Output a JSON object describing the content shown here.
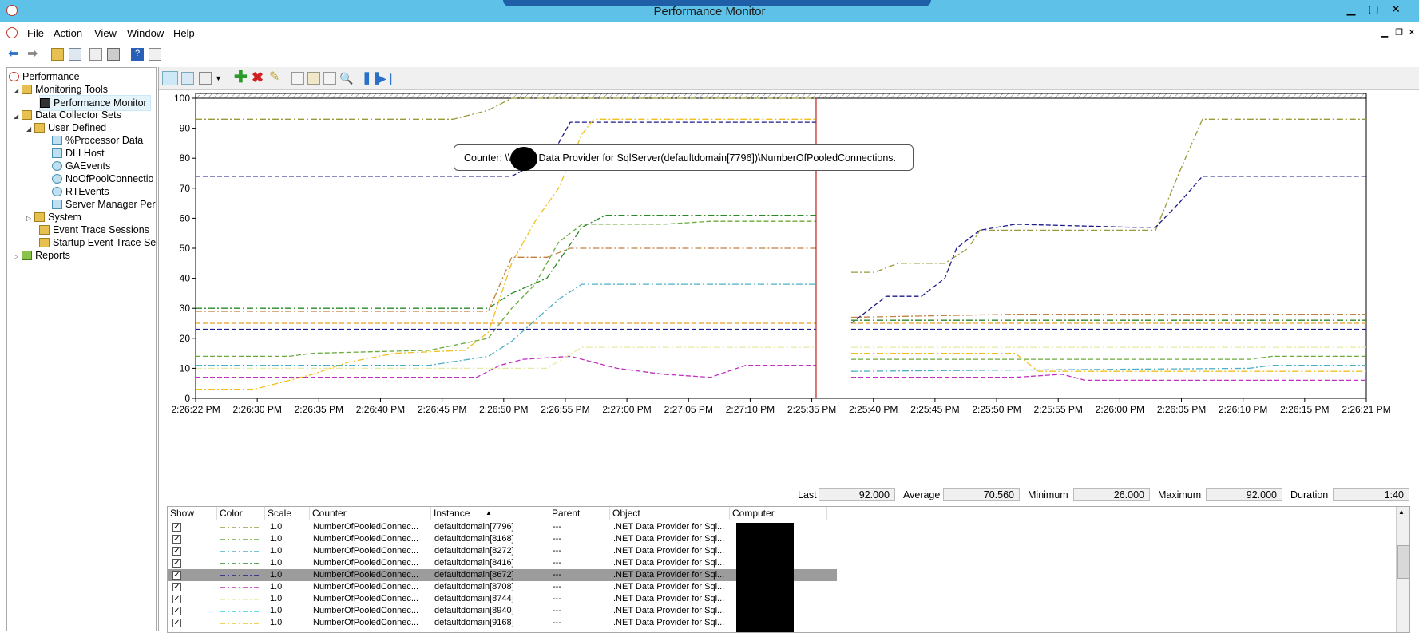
{
  "window": {
    "title": "Performance Monitor"
  },
  "menu": [
    "File",
    "Action",
    "View",
    "Window",
    "Help"
  ],
  "tree": {
    "items": [
      {
        "label": "Performance",
        "level": 0
      },
      {
        "label": "Monitoring Tools",
        "level": 1
      },
      {
        "label": "Performance Monitor",
        "level": 2
      },
      {
        "label": "Data Collector Sets",
        "level": 1
      },
      {
        "label": "User Defined",
        "level": 2
      },
      {
        "label": "%Processor Data",
        "level": 3
      },
      {
        "label": "DLLHost",
        "level": 3
      },
      {
        "label": "GAEvents",
        "level": 3
      },
      {
        "label": "NoOfPoolConnectio",
        "level": 3
      },
      {
        "label": "RTEvents",
        "level": 3
      },
      {
        "label": "Server Manager Per",
        "level": 3
      },
      {
        "label": "System",
        "level": 2
      },
      {
        "label": "Event Trace Sessions",
        "level": 2
      },
      {
        "label": "Startup Event Trace Ses",
        "level": 2
      },
      {
        "label": "Reports",
        "level": 0
      }
    ]
  },
  "tooltip": {
    "text": "Counter: \\\\        .NET Data Provider for SqlServer(defaultdomain[7796])\\NumberOfPooledConnections."
  },
  "stats": {
    "last_label": "Last",
    "last": "92.000",
    "avg_label": "Average",
    "avg": "70.560",
    "min_label": "Minimum",
    "min": "26.000",
    "max_label": "Maximum",
    "max": "92.000",
    "dur_label": "Duration",
    "dur": "1:40"
  },
  "legend": {
    "headers": [
      "Show",
      "Color",
      "Scale",
      "Counter",
      "Instance",
      "Parent",
      "Object",
      "Computer"
    ],
    "rows": [
      {
        "scale": "1.0",
        "counter": "NumberOfPooledConnec...",
        "instance": "defaultdomain[7796]",
        "parent": "---",
        "object": ".NET Data Provider for Sql...",
        "color": "#9a9a3a",
        "selected": false
      },
      {
        "scale": "1.0",
        "counter": "NumberOfPooledConnec...",
        "instance": "defaultdomain[8168]",
        "parent": "---",
        "object": ".NET Data Provider for Sql...",
        "color": "#6aaa3a",
        "selected": false
      },
      {
        "scale": "1.0",
        "counter": "NumberOfPooledConnec...",
        "instance": "defaultdomain[8272]",
        "parent": "---",
        "object": ".NET Data Provider for Sql...",
        "color": "#4ab0c8",
        "selected": false
      },
      {
        "scale": "1.0",
        "counter": "NumberOfPooledConnec...",
        "instance": "defaultdomain[8416]",
        "parent": "---",
        "object": ".NET Data Provider for Sql...",
        "color": "#2a8a2a",
        "selected": false
      },
      {
        "scale": "1.0",
        "counter": "NumberOfPooledConnec...",
        "instance": "defaultdomain[8672]",
        "parent": "---",
        "object": ".NET Data Provider for Sql...",
        "color": "#1a1a8a",
        "selected": true
      },
      {
        "scale": "1.0",
        "counter": "NumberOfPooledConnec...",
        "instance": "defaultdomain[8708]",
        "parent": "---",
        "object": ".NET Data Provider for Sql...",
        "color": "#c030c0",
        "selected": false
      },
      {
        "scale": "1.0",
        "counter": "NumberOfPooledConnec...",
        "instance": "defaultdomain[8744]",
        "parent": "---",
        "object": ".NET Data Provider for Sql...",
        "color": "#e8e8a0",
        "selected": false
      },
      {
        "scale": "1.0",
        "counter": "NumberOfPooledConnec...",
        "instance": "defaultdomain[8940]",
        "parent": "---",
        "object": ".NET Data Provider for Sql...",
        "color": "#30d0e0",
        "selected": false
      },
      {
        "scale": "1.0",
        "counter": "NumberOfPooledConnec...",
        "instance": "defaultdomain[9168]",
        "parent": "---",
        "object": ".NET Data Provider for Sql...",
        "color": "#f0c020",
        "selected": false
      }
    ]
  },
  "chart_data": {
    "type": "line",
    "ylim": [
      0,
      100
    ],
    "yticks": [
      "100",
      "90",
      "80",
      "70",
      "60",
      "50",
      "40",
      "30",
      "20",
      "10",
      "0"
    ],
    "xticks": [
      "2:26:22 PM",
      "2:26:30 PM",
      "2:26:35 PM",
      "2:26:40 PM",
      "2:26:45 PM",
      "2:26:50 PM",
      "2:26:55 PM",
      "2:27:00 PM",
      "2:27:05 PM",
      "2:27:10 PM",
      "2:25:35 PM",
      "2:25:40 PM",
      "2:25:45 PM",
      "2:25:50 PM",
      "2:25:55 PM",
      "2:26:00 PM",
      "2:26:05 PM",
      "2:26:10 PM",
      "2:26:15 PM",
      "2:26:21 PM"
    ],
    "x_samples": 100,
    "gap": [
      53,
      56
    ],
    "series": [
      {
        "color": "#9a9a3a",
        "values": [
          [
            0,
            93
          ],
          [
            22,
            93
          ],
          [
            25,
            96
          ],
          [
            27,
            100
          ],
          [
            53,
            100
          ],
          [
            56,
            42
          ],
          [
            58,
            42
          ],
          [
            60,
            45
          ],
          [
            64,
            45
          ],
          [
            66,
            50
          ],
          [
            67,
            56
          ],
          [
            80,
            56
          ],
          [
            82,
            56
          ],
          [
            84,
            75
          ],
          [
            86,
            93
          ],
          [
            100,
            93
          ]
        ]
      },
      {
        "color": "#1a1a8a",
        "values": [
          [
            0,
            74
          ],
          [
            27,
            74
          ],
          [
            29,
            78
          ],
          [
            31,
            85
          ],
          [
            32,
            92
          ],
          [
            53,
            92
          ],
          [
            56,
            25
          ],
          [
            59,
            34
          ],
          [
            62,
            34
          ],
          [
            64,
            40
          ],
          [
            65,
            50
          ],
          [
            67,
            56
          ],
          [
            70,
            58
          ],
          [
            80,
            57
          ],
          [
            82,
            57
          ],
          [
            84,
            65
          ],
          [
            86,
            74
          ],
          [
            100,
            74
          ]
        ]
      },
      {
        "color": "#2a8a2a",
        "values": [
          [
            0,
            30
          ],
          [
            25,
            30
          ],
          [
            27,
            35
          ],
          [
            30,
            40
          ],
          [
            33,
            57
          ],
          [
            35,
            61
          ],
          [
            53,
            61
          ],
          [
            56,
            26
          ],
          [
            100,
            26
          ]
        ]
      },
      {
        "color": "#6aaa3a",
        "values": [
          [
            0,
            14
          ],
          [
            8,
            14
          ],
          [
            10,
            15
          ],
          [
            20,
            16
          ],
          [
            25,
            20
          ],
          [
            27,
            30
          ],
          [
            29,
            38
          ],
          [
            31,
            52
          ],
          [
            33,
            58
          ],
          [
            40,
            58
          ],
          [
            44,
            59
          ],
          [
            53,
            59
          ],
          [
            56,
            13
          ],
          [
            90,
            13
          ],
          [
            92,
            14
          ],
          [
            100,
            14
          ]
        ]
      },
      {
        "color": "#4ab0c8",
        "values": [
          [
            0,
            11
          ],
          [
            20,
            11
          ],
          [
            25,
            14
          ],
          [
            27,
            19
          ],
          [
            29,
            26
          ],
          [
            31,
            33
          ],
          [
            33,
            38
          ],
          [
            53,
            38
          ],
          [
            56,
            9
          ],
          [
            90,
            10
          ],
          [
            92,
            11
          ],
          [
            100,
            11
          ]
        ]
      },
      {
        "color": "#c030c0",
        "values": [
          [
            0,
            7
          ],
          [
            24,
            7
          ],
          [
            26,
            11
          ],
          [
            28,
            13
          ],
          [
            32,
            14
          ],
          [
            36,
            10
          ],
          [
            40,
            8
          ],
          [
            44,
            7
          ],
          [
            47,
            11
          ],
          [
            53,
            11
          ],
          [
            56,
            7
          ],
          [
            70,
            7
          ],
          [
            74,
            8
          ],
          [
            76,
            6
          ],
          [
            100,
            6
          ]
        ]
      },
      {
        "color": "#f0c020",
        "values": [
          [
            0,
            3
          ],
          [
            5,
            3
          ],
          [
            10,
            8
          ],
          [
            13,
            12
          ],
          [
            17,
            15
          ],
          [
            23,
            16
          ],
          [
            25,
            22
          ],
          [
            27,
            45
          ],
          [
            29,
            59
          ],
          [
            31,
            70
          ],
          [
            33,
            88
          ],
          [
            34,
            93
          ],
          [
            53,
            93
          ],
          [
            56,
            15
          ],
          [
            70,
            15
          ],
          [
            72,
            9
          ],
          [
            100,
            9
          ]
        ]
      },
      {
        "color": "#30d0e0",
        "values": [
          [
            0,
            4
          ],
          [
            100,
            4
          ]
        ]
      },
      {
        "color": "#e8e8a0",
        "values": [
          [
            0,
            10
          ],
          [
            30,
            10
          ],
          [
            33,
            17
          ],
          [
            53,
            17
          ],
          [
            56,
            17
          ],
          [
            100,
            17
          ]
        ]
      },
      {
        "color": "#1a1a8a",
        "values": [
          [
            0,
            23
          ],
          [
            53,
            23
          ],
          [
            56,
            23
          ],
          [
            100,
            23
          ]
        ]
      },
      {
        "color": "#c08040",
        "values": [
          [
            0,
            29
          ],
          [
            25,
            29
          ],
          [
            27,
            47
          ],
          [
            30,
            47
          ],
          [
            32,
            50
          ],
          [
            53,
            50
          ],
          [
            56,
            27
          ],
          [
            70,
            28
          ],
          [
            100,
            28
          ]
        ]
      },
      {
        "color": "#e8a020",
        "values": [
          [
            0,
            25
          ],
          [
            53,
            25
          ],
          [
            56,
            25
          ],
          [
            100,
            25
          ]
        ]
      },
      {
        "color": "#d04040",
        "values": [
          [
            0,
            1
          ],
          [
            100,
            1
          ]
        ]
      },
      {
        "color": "#8040c0",
        "values": [
          [
            0,
            2
          ],
          [
            100,
            2
          ]
        ]
      },
      {
        "color": "#40a0a0",
        "values": [
          [
            0,
            5
          ],
          [
            100,
            5
          ]
        ]
      }
    ]
  }
}
